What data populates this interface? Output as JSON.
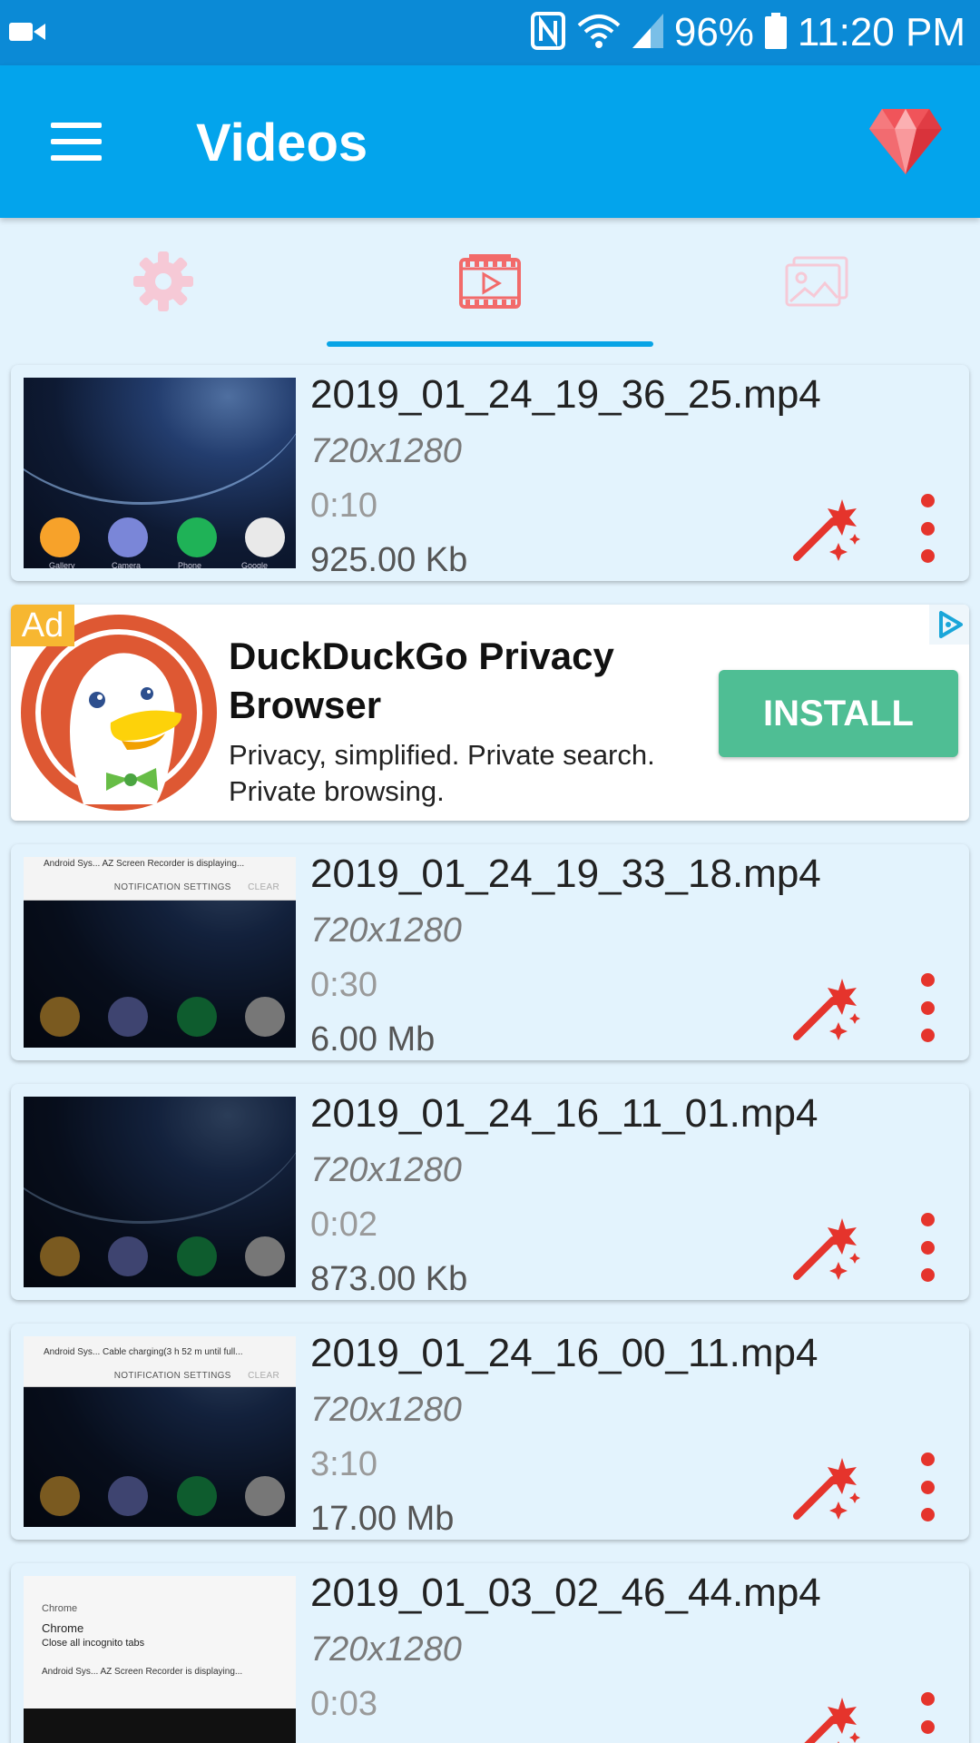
{
  "status_bar": {
    "battery": "96%",
    "time": "11:20 PM",
    "icons": [
      "video-camera-icon",
      "nfc-icon",
      "wifi-icon",
      "signal-icon",
      "battery-icon"
    ]
  },
  "app_bar": {
    "title": "Videos",
    "menu_icon": "hamburger-menu-icon",
    "premium_icon": "ruby-gem-icon"
  },
  "tabs": [
    {
      "name": "settings",
      "icon": "gear-icon",
      "selected": false
    },
    {
      "name": "videos",
      "icon": "video-film-icon",
      "selected": true
    },
    {
      "name": "images",
      "icon": "image-gallery-icon",
      "selected": false
    }
  ],
  "colors": {
    "app_bar": "#03a4ec",
    "status_bar": "#0b8ad6",
    "background": "#e3f3fd",
    "accent_red": "#e5342c",
    "install_green": "#4fbe94"
  },
  "videos": [
    {
      "filename": "2019_01_24_19_36_25.mp4",
      "resolution": "720x1280",
      "duration": "0:10",
      "size": "925.00 Kb"
    },
    {
      "filename": "2019_01_24_19_33_18.mp4",
      "resolution": "720x1280",
      "duration": "0:30",
      "size": "6.00 Mb"
    },
    {
      "filename": "2019_01_24_16_11_01.mp4",
      "resolution": "720x1280",
      "duration": "0:02",
      "size": "873.00 Kb"
    },
    {
      "filename": "2019_01_24_16_00_11.mp4",
      "resolution": "720x1280",
      "duration": "3:10",
      "size": "17.00 Mb"
    },
    {
      "filename": "2019_01_03_02_46_44.mp4",
      "resolution": "720x1280",
      "duration": "0:03",
      "size": ""
    }
  ],
  "thumbnails": {
    "dock_labels": [
      "Gallery",
      "Camera",
      "Phone",
      "Google"
    ],
    "notif_1": "Android Sys...  AZ Screen Recorder is displaying...",
    "notif_2": "Android Sys...  Cable charging(3 h 52 m until full...",
    "notif_settings": "NOTIFICATION SETTINGS",
    "notif_clear": "CLEAR",
    "chrome_app": "Chrome",
    "chrome_title": "Chrome",
    "chrome_text": "Close all incognito tabs"
  },
  "ad": {
    "badge": "Ad",
    "title": "DuckDuckGo Privacy Browser",
    "description": "Privacy, simplified. Private search. Private browsing.",
    "button": "INSTALL"
  }
}
